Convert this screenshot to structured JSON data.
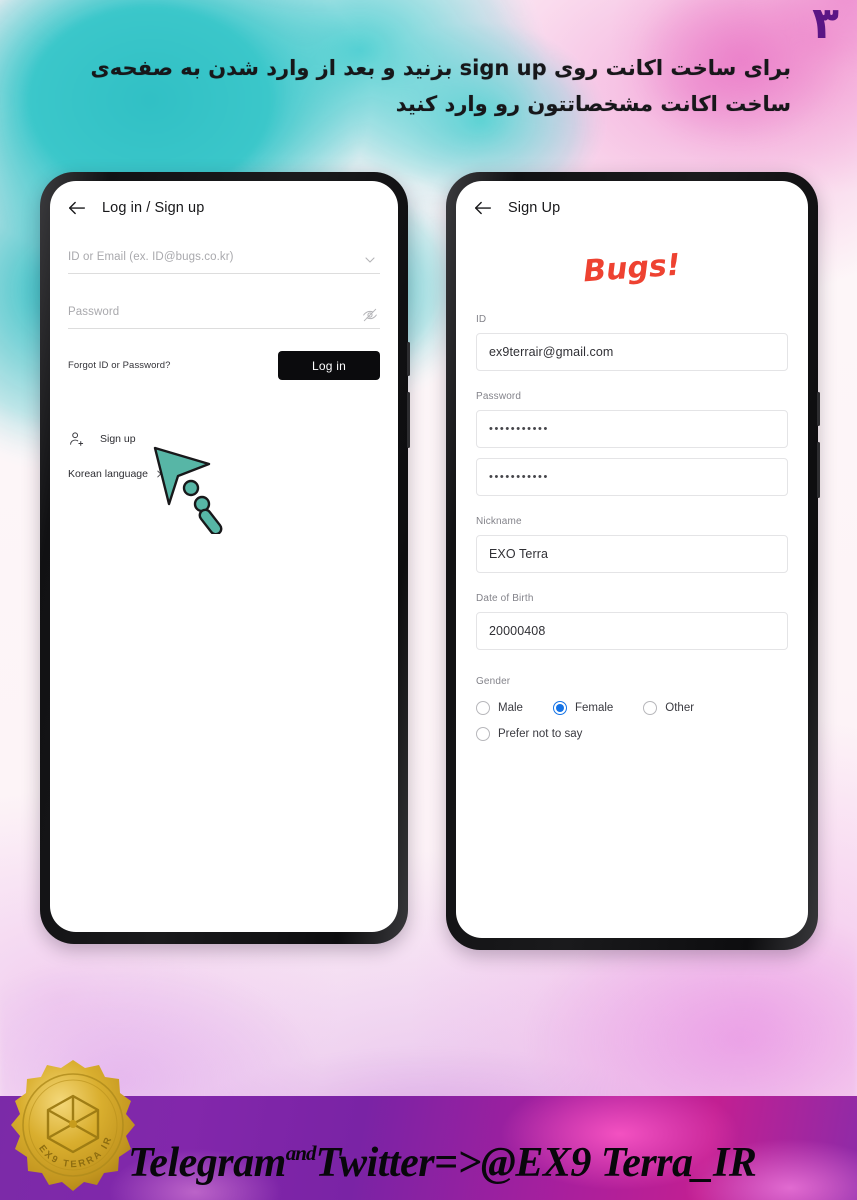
{
  "page": {
    "number": "۳",
    "caption_line1": "برای ساخت اکانت روی sign up  بزنید و بعد از وارد شدن به صفحه‌ی",
    "caption_line2": "ساخت اکانت مشخصاتتون رو وارد کنید"
  },
  "left_phone": {
    "appbar": {
      "title": "Log in / Sign up",
      "back_icon": "back-arrow-icon"
    },
    "id_field": {
      "placeholder": "ID or Email (ex. ID@bugs.co.kr)",
      "value": "",
      "icon": "chevron-down-icon"
    },
    "password_field": {
      "placeholder": "Password",
      "value": "",
      "icon": "eye-off-icon"
    },
    "forgot_link": "Forgot ID or Password?",
    "login_button": "Log in",
    "signup_link": "Sign up",
    "signup_icon": "person-add-icon",
    "korean_link": "Korean language",
    "korean_icon": "chevron-right-icon",
    "cursor_icon": "pointer-cursor-icon"
  },
  "right_phone": {
    "appbar": {
      "title": "Sign Up",
      "back_icon": "back-arrow-icon"
    },
    "logo": {
      "text": "Bugs!",
      "color": "#ee4231"
    },
    "fields": [
      {
        "label": "ID",
        "value": "ex9terrair@gmail.com",
        "type": "text"
      },
      {
        "label": "Password",
        "value": "•••••••••••",
        "type": "password"
      },
      {
        "label": "",
        "value": "•••••••••••",
        "type": "password"
      },
      {
        "label": "Nickname",
        "value": "EXO Terra",
        "type": "text",
        "caret_after": "EXO"
      },
      {
        "label": "Date of Birth",
        "value": "20000408",
        "type": "text"
      }
    ],
    "gender": {
      "label": "Gender",
      "options": [
        {
          "label": "Male",
          "selected": false
        },
        {
          "label": "Female",
          "selected": true
        },
        {
          "label": "Other",
          "selected": false
        },
        {
          "label": "Prefer not to say",
          "selected": false
        }
      ],
      "accent": "#1473e6"
    }
  },
  "footer": {
    "part1": "Telegram",
    "sup": "and",
    "part2": "Twitter=>@EX9 Terra_IR",
    "seal_text_top": "EX9 TERRA IR",
    "seal_text_bottom": "EX9 TERRA IR",
    "band_color": "#8227ab"
  }
}
